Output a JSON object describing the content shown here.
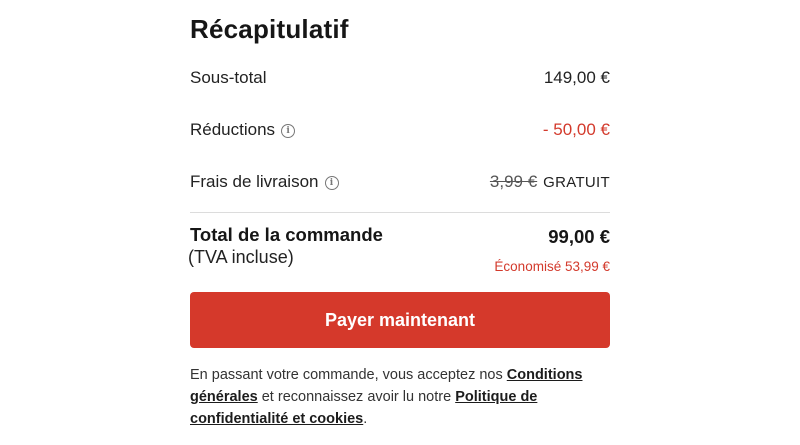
{
  "summary": {
    "title": "Récapitulatif",
    "subtotal": {
      "label": "Sous-total",
      "value": "149,00 €"
    },
    "discounts": {
      "label": "Réductions",
      "value": "- 50,00 €"
    },
    "shipping": {
      "label": "Frais de livraison",
      "old_value": "3,99 €",
      "value": "GRATUIT"
    },
    "total": {
      "label": "Total de la commande",
      "sub_label": "(TVA incluse)",
      "value": "99,00 €",
      "savings": "Économisé 53,99 €"
    },
    "pay_button_label": "Payer maintenant",
    "legal": {
      "text_1": "En passant votre commande, vous acceptez nos ",
      "link_terms": "Conditions générales",
      "text_2": " et reconnaissez avoir lu notre ",
      "link_privacy": "Politique de confidentialité et cookies",
      "text_3": "."
    }
  },
  "colors": {
    "accent": "#d5392b",
    "discount_red": "#d33a2c",
    "text": "#1c1c1c",
    "divider": "#dcdcdc"
  },
  "icons": {
    "info": "info-icon"
  }
}
